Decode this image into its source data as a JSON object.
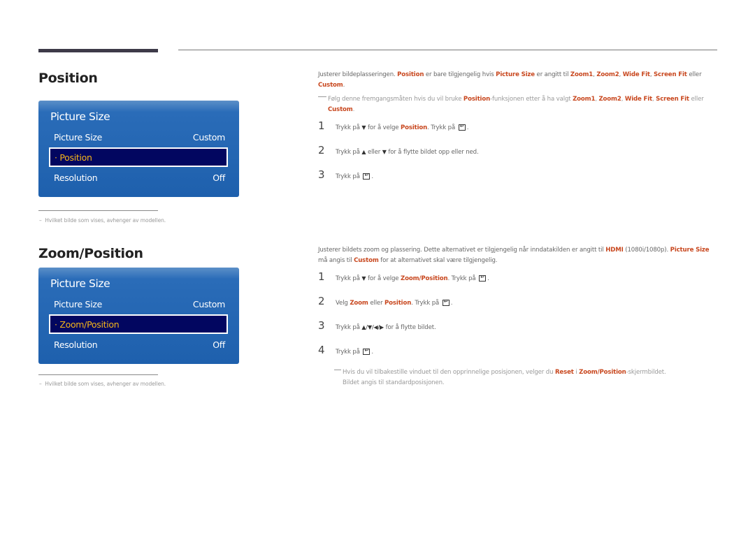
{
  "sections": [
    {
      "title": "Position",
      "menu": {
        "title": "Picture Size",
        "rows": [
          {
            "label": "Picture Size",
            "value": "Custom"
          },
          {
            "label": "· Position",
            "value": ""
          },
          {
            "label": "Resolution",
            "value": "Off"
          }
        ]
      },
      "footnote": "Hvilket bilde som vises, avhenger av modellen.",
      "description": {
        "p1": "Justerer bildeplasseringen. ",
        "h1": "Position",
        "p2": " er bare tilgjengelig hvis ",
        "h2": "Picture Size",
        "p3": " er angitt til ",
        "h3": "Zoom1",
        "p4": ", ",
        "h4": "Zoom2",
        "p5": ", ",
        "h5": "Wide Fit",
        "p6": ", ",
        "h6": "Screen Fit",
        "p7": " eller ",
        "h7": "Custom",
        "p8": "."
      },
      "note": {
        "p1": "Følg denne fremgangsmåten hvis du vil bruke ",
        "h1": "Position",
        "p2": "-funksjonen etter å ha valgt ",
        "h2": "Zoom1",
        "p3": ", ",
        "h3": "Zoom2",
        "p4": ", ",
        "h4": "Wide Fit",
        "p5": ", ",
        "h5": "Screen Fit",
        "p6": " eller ",
        "h6": "Custom",
        "p7": "."
      },
      "steps": [
        {
          "num": "1",
          "a": "Trykk på ",
          "icon1": "▼",
          "b": " for å velge ",
          "h": "Position",
          "c": ". Trykk på ",
          "d": "."
        },
        {
          "num": "2",
          "a": "Trykk på ",
          "icon1": "▲",
          "b": " eller ",
          "icon2": "▼",
          "c": " for å flytte bildet opp eller ned."
        },
        {
          "num": "3",
          "a": "Trykk på ",
          "d": "."
        }
      ]
    },
    {
      "title": "Zoom/Position",
      "menu": {
        "title": "Picture Size",
        "rows": [
          {
            "label": "Picture Size",
            "value": "Custom"
          },
          {
            "label": "· Zoom/Position",
            "value": ""
          },
          {
            "label": "Resolution",
            "value": "Off"
          }
        ]
      },
      "footnote": "Hvilket bilde som vises, avhenger av modellen.",
      "description": {
        "p1": "Justerer bildets zoom og plassering. Dette alternativet er tilgjengelig når inndatakilden er angitt til ",
        "h1": "HDMI",
        "p2": " (1080i/1080p). ",
        "h2": "Picture Size",
        "p3": " må angis til ",
        "h3": "Custom",
        "p4": " for at alternativet skal være tilgjengelig."
      },
      "steps": [
        {
          "num": "1",
          "a": "Trykk på ",
          "icon1": "▼",
          "b": " for å velge ",
          "h": "Zoom/Position",
          "c": ". Trykk på ",
          "d": "."
        },
        {
          "num": "2",
          "a": "Velg ",
          "h1": "Zoom",
          "b": " eller ",
          "h2": "Position",
          "c": ". Trykk på ",
          "d": "."
        },
        {
          "num": "3",
          "a": "Trykk på ",
          "icons": "▲/▼/◀/▶",
          "b": " for å flytte bildet."
        },
        {
          "num": "4",
          "a": "Trykk på ",
          "d": "."
        }
      ],
      "note": {
        "p1": "Hvis du vil tilbakestille vinduet til den opprinnelige posisjonen, velger du ",
        "h1": "Reset",
        "p2": " i ",
        "h2": "Zoom/Position",
        "p3": "-skjermbildet.",
        "line2": "Bildet angis til standardposisjonen."
      }
    }
  ],
  "colors": {
    "highlight": "#c8471e",
    "menu_bg": "#1e60ad",
    "menu_selected_bg": "#020660",
    "menu_selected_text": "#f6b51a"
  }
}
